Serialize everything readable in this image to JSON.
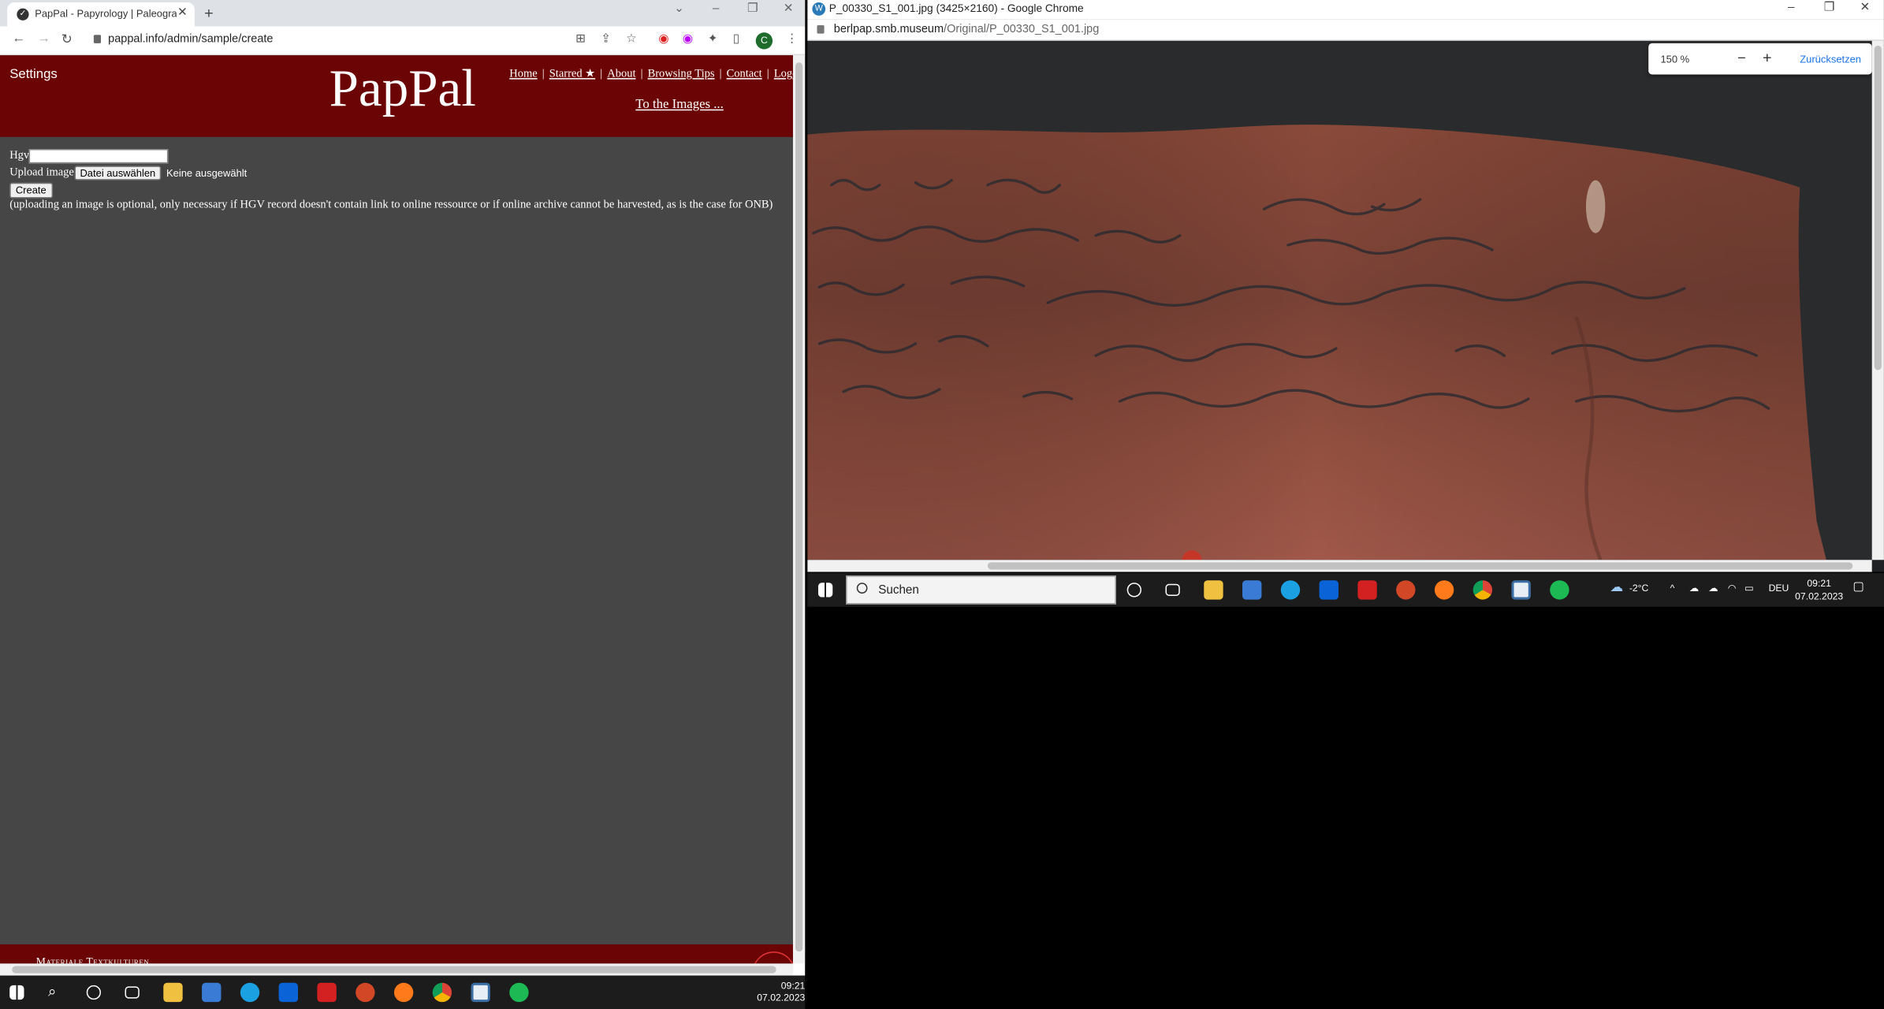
{
  "left_browser": {
    "tab_title": "PapPal - Papyrology | Paleograph",
    "tab_favicon": "pappal-favicon",
    "url": "pappal.info/admin/sample/create",
    "profile_initial": "C"
  },
  "site": {
    "settings_label": "Settings",
    "logo": "PapPal",
    "nav": [
      "Home",
      "Starred ★",
      "About",
      "Browsing Tips",
      "Contact",
      "Logout"
    ],
    "nav_sep": "|",
    "to_images": "To the Images ...",
    "colors": {
      "header_bg": "#6b0404",
      "page_bg": "#464646"
    }
  },
  "form": {
    "hgv_label": "Hgv",
    "hgv_value": "",
    "upload_label": "Upload image",
    "file_button": "Datei auswählen",
    "file_status": "Keine ausgewählt",
    "create_button": "Create",
    "note": "(uploading an image is optional, only necessary if HGV record doesn't contain link to online ressource or if online archive cannot be harvested, as is the case for ONB)"
  },
  "footer": {
    "text": "Materiale Textkulturen"
  },
  "left_taskbar": {
    "time": "09:21",
    "date": "07.02.2023"
  },
  "right_browser": {
    "window_title": "P_00330_S1_001.jpg (3425×2160) - Google Chrome",
    "url_host": "berlpap.smb.museum",
    "url_path": "/Original/P_00330_S1_001.jpg",
    "zoom_level": "150 %",
    "zoom_out": "−",
    "zoom_in": "+",
    "reset_label": "Zurücksetzen"
  },
  "right_taskbar": {
    "search_placeholder": "Suchen",
    "weather": "-2°C",
    "language": "DEU",
    "time": "09:21",
    "date": "07.02.2023"
  }
}
